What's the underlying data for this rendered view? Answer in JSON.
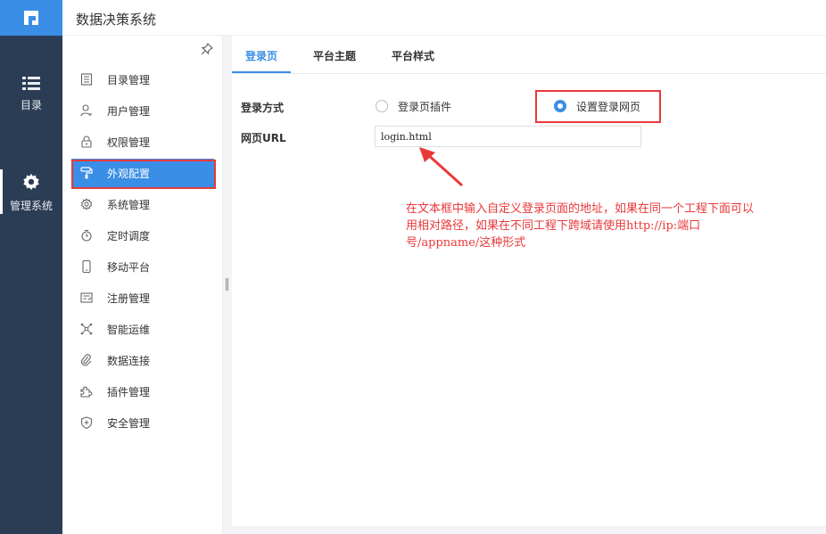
{
  "app": {
    "title": "数据决策系统"
  },
  "rail": {
    "items": [
      {
        "label": "目录",
        "icon": "list-icon"
      },
      {
        "label": "管理系统",
        "icon": "gear-icon"
      }
    ],
    "active": "管理系统"
  },
  "sidebar": {
    "items": [
      {
        "label": "目录管理",
        "icon": "catalog-icon"
      },
      {
        "label": "用户管理",
        "icon": "user-icon"
      },
      {
        "label": "权限管理",
        "icon": "lock-icon"
      },
      {
        "label": "外观配置",
        "icon": "paint-roller-icon"
      },
      {
        "label": "系统管理",
        "icon": "gear-icon"
      },
      {
        "label": "定时调度",
        "icon": "timer-icon"
      },
      {
        "label": "移动平台",
        "icon": "mobile-icon"
      },
      {
        "label": "注册管理",
        "icon": "register-icon"
      },
      {
        "label": "智能运维",
        "icon": "network-icon"
      },
      {
        "label": "数据连接",
        "icon": "link-icon"
      },
      {
        "label": "插件管理",
        "icon": "puzzle-icon"
      },
      {
        "label": "安全管理",
        "icon": "shield-icon"
      }
    ],
    "active": "外观配置"
  },
  "tabs": [
    {
      "label": "登录页"
    },
    {
      "label": "平台主题"
    },
    {
      "label": "平台样式"
    }
  ],
  "active_tab": "登录页",
  "form": {
    "login_method_label": "登录方式",
    "option_plugin": "登录页插件",
    "option_webpage": "设置登录网页",
    "selected_option": "设置登录网页",
    "url_label": "网页URL",
    "url_value": "login.html"
  },
  "annotation": {
    "text": "在文本框中输入自定义登录页面的地址，如果在同一个工程下面可以用相对路径，如果在不同工程下跨域请使用http://ip:端口号/appname/这种形式"
  },
  "colors": {
    "accent": "#3a8ee6",
    "rail_bg": "#2b3d55",
    "annotation_red": "#e9393b"
  }
}
